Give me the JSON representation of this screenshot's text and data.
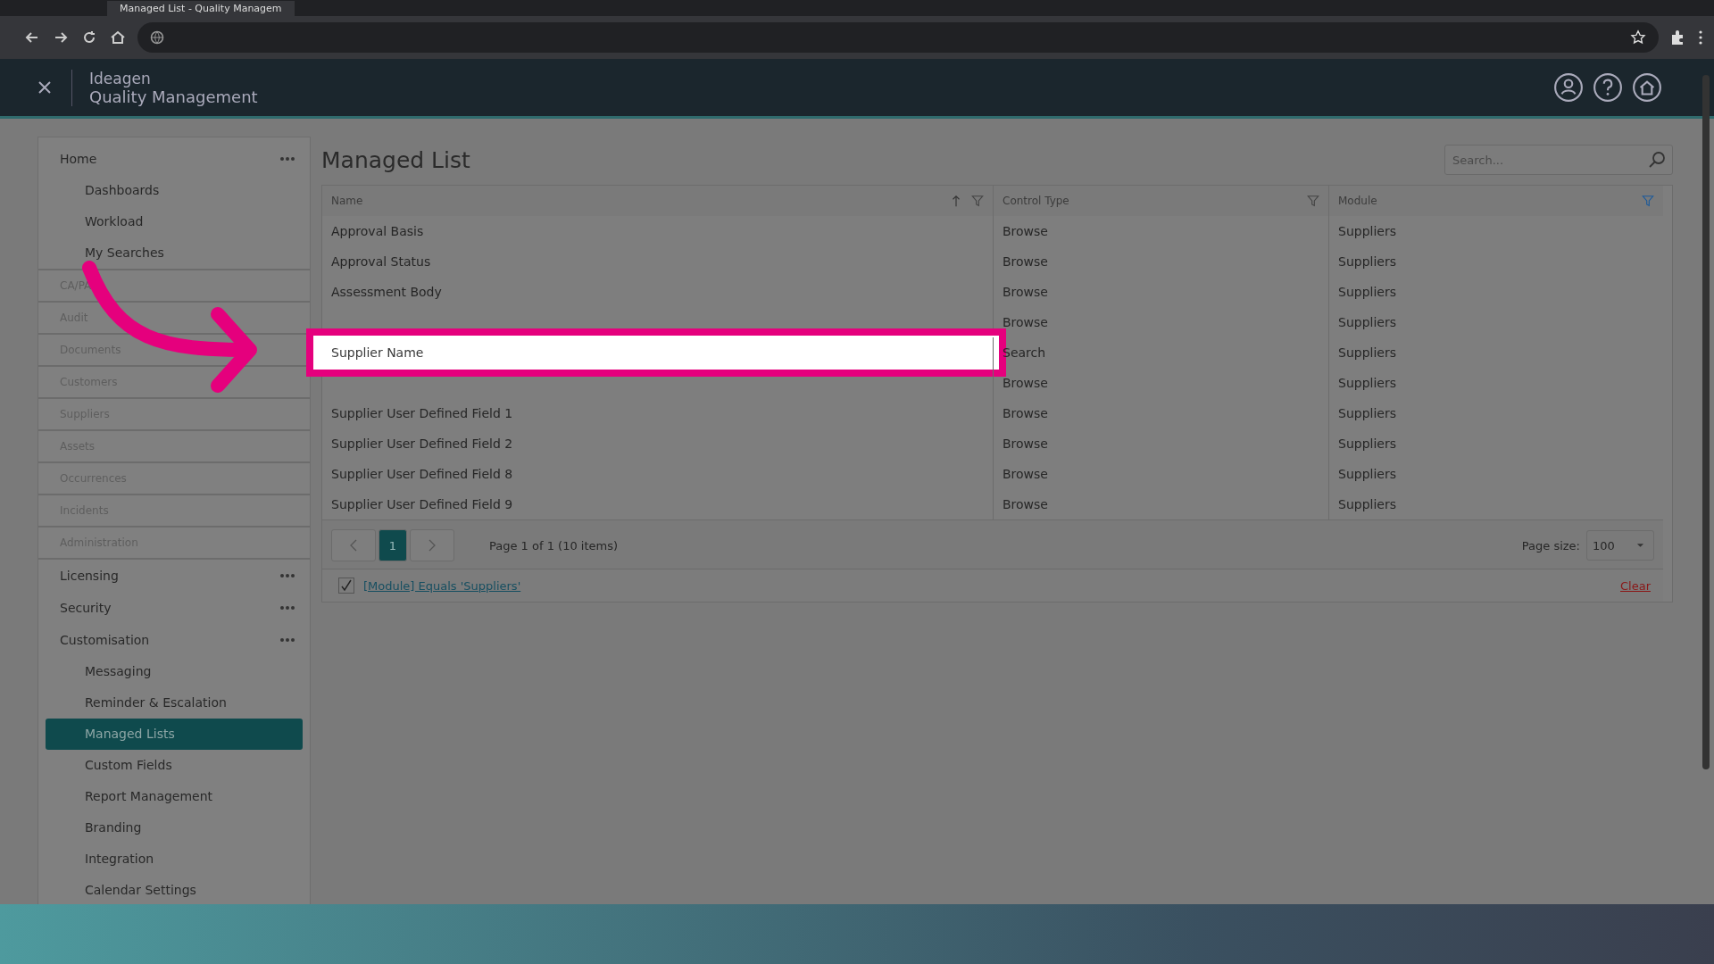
{
  "browser": {
    "tab_title": "Managed List - Quality Managem"
  },
  "app": {
    "brand": "Ideagen",
    "product": "Quality Management"
  },
  "sidebar": {
    "items": [
      {
        "label": "Home",
        "kind": "group",
        "children": [
          {
            "label": "Dashboards",
            "selected": false
          },
          {
            "label": "Workload",
            "selected": false
          },
          {
            "label": "My Searches",
            "selected": false
          }
        ]
      },
      {
        "label": "CA/PA",
        "kind": "module"
      },
      {
        "label": "Audit",
        "kind": "module"
      },
      {
        "label": "Documents",
        "kind": "module"
      },
      {
        "label": "Customers",
        "kind": "module"
      },
      {
        "label": "Suppliers",
        "kind": "module"
      },
      {
        "label": "Assets",
        "kind": "module"
      },
      {
        "label": "Occurrences",
        "kind": "module"
      },
      {
        "label": "Incidents",
        "kind": "module"
      },
      {
        "label": "Administration",
        "kind": "module"
      },
      {
        "label": "Licensing",
        "kind": "group"
      },
      {
        "label": "Security",
        "kind": "group"
      },
      {
        "label": "Customisation",
        "kind": "group",
        "children": [
          {
            "label": "Messaging",
            "selected": false
          },
          {
            "label": "Reminder & Escalation",
            "selected": false
          },
          {
            "label": "Managed Lists",
            "selected": true
          },
          {
            "label": "Custom Fields",
            "selected": false
          },
          {
            "label": "Report Management",
            "selected": false
          },
          {
            "label": "Branding",
            "selected": false
          },
          {
            "label": "Integration",
            "selected": false
          },
          {
            "label": "Calendar Settings",
            "selected": false
          }
        ]
      }
    ]
  },
  "page": {
    "title": "Managed List",
    "search": {
      "placeholder": "Search..."
    }
  },
  "table": {
    "columns": [
      {
        "label": "Name",
        "sorted": true,
        "filtered": false
      },
      {
        "label": "Control Type",
        "sorted": false,
        "filtered": false
      },
      {
        "label": "Module",
        "sorted": false,
        "filtered": true
      }
    ],
    "rows": [
      {
        "name": "Approval Basis",
        "control_type": "Browse",
        "module": "Suppliers",
        "highlighted": false
      },
      {
        "name": "Approval Status",
        "control_type": "Browse",
        "module": "Suppliers",
        "highlighted": false
      },
      {
        "name": "Assessment Body",
        "control_type": "Browse",
        "module": "Suppliers",
        "highlighted": false
      },
      {
        "control_type": "Browse",
        "module": "Suppliers",
        "highlighted": false
      },
      {
        "name": "Supplier Name",
        "control_type": "Search",
        "module": "Suppliers",
        "highlighted": true
      },
      {
        "control_type": "Browse",
        "module": "Suppliers",
        "highlighted": false
      },
      {
        "name": "Supplier User Defined Field 1",
        "control_type": "Browse",
        "module": "Suppliers",
        "highlighted": false
      },
      {
        "name": "Supplier User Defined Field 2",
        "control_type": "Browse",
        "module": "Suppliers",
        "highlighted": false
      },
      {
        "name": "Supplier User Defined Field 8",
        "control_type": "Browse",
        "module": "Suppliers",
        "highlighted": false
      },
      {
        "name": "Supplier User Defined Field 9",
        "control_type": "Browse",
        "module": "Suppliers",
        "highlighted": false
      }
    ]
  },
  "pager": {
    "pages": [
      {
        "label": "1",
        "selected": true
      }
    ],
    "summary": "Page 1 of 1 (10 items)",
    "page_size_label": "Page size:",
    "page_size": "100"
  },
  "filter": {
    "checked": true,
    "expression": "[Module] Equals 'Suppliers'",
    "clear": "Clear"
  }
}
